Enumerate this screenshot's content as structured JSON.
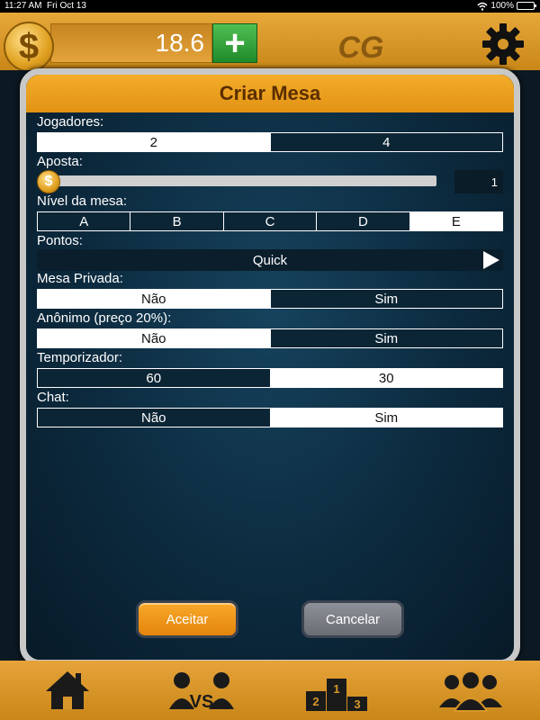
{
  "status_bar": {
    "time": "11:27 AM",
    "date": "Fri Oct 13",
    "battery": "100%"
  },
  "top_bar": {
    "coin_symbol": "$",
    "balance": "18.6",
    "add_symbol": "+",
    "logo_text": "CG",
    "colors": {
      "bar": "#d8972a",
      "add": "#2d9a35"
    }
  },
  "modal": {
    "title": "Criar Mesa",
    "players": {
      "label": "Jogadores:",
      "options": [
        "2",
        "4"
      ],
      "selected": 0
    },
    "bet": {
      "label": "Aposta:",
      "coin_symbol": "$",
      "value": "1",
      "slider_fraction": 0
    },
    "table_level": {
      "label": "Nível da mesa:",
      "options": [
        "A",
        "B",
        "C",
        "D",
        "E"
      ],
      "selected": 4
    },
    "points": {
      "label": "Pontos:",
      "value": "Quick"
    },
    "private": {
      "label": "Mesa Privada:",
      "options": [
        "Não",
        "Sim"
      ],
      "selected": 0
    },
    "anonymous": {
      "label": "Anônimo (preço 20%):",
      "options": [
        "Não",
        "Sim"
      ],
      "selected": 0
    },
    "timer": {
      "label": "Temporizador:",
      "options": [
        "60",
        "30"
      ],
      "selected": 1
    },
    "chat": {
      "label": "Chat:",
      "options": [
        "Não",
        "Sim"
      ],
      "selected": 1
    },
    "accept_label": "Aceitar",
    "cancel_label": "Cancelar"
  },
  "bottom_nav": {
    "items": [
      "home-icon",
      "versus-icon",
      "podium-icon",
      "group-icon"
    ],
    "vs_text": "VS",
    "podium_numbers": [
      "2",
      "1",
      "3"
    ]
  }
}
